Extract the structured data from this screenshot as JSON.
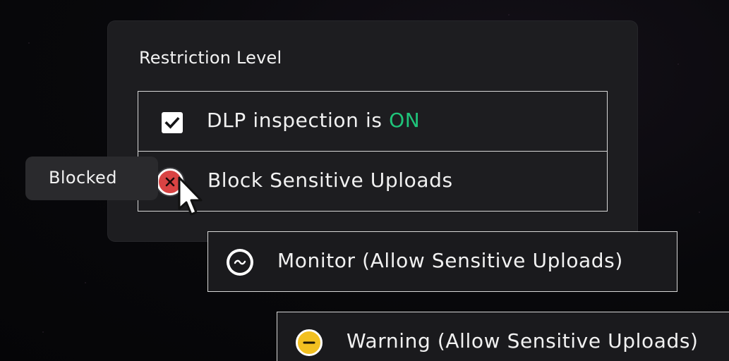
{
  "panel": {
    "title": "Restriction Level"
  },
  "rows": {
    "dlp": {
      "label_prefix": "DLP inspection is ",
      "status": "ON",
      "status_color": "#1fc47a",
      "checked": true
    },
    "block": {
      "label": "Block Sensitive Uploads",
      "icon_color": "#d94343"
    },
    "monitor": {
      "label": "Monitor (Allow Sensitive Uploads)"
    },
    "warning": {
      "label": "Warning (Allow Sensitive Uploads)",
      "icon_color": "#f2c021"
    }
  },
  "tooltip": {
    "label": "Blocked"
  },
  "icons": {
    "check": "check-icon",
    "block": "x-circle-icon",
    "monitor": "tilde-circle-icon",
    "warning": "minus-circle-icon",
    "cursor": "mouse-pointer-icon"
  }
}
